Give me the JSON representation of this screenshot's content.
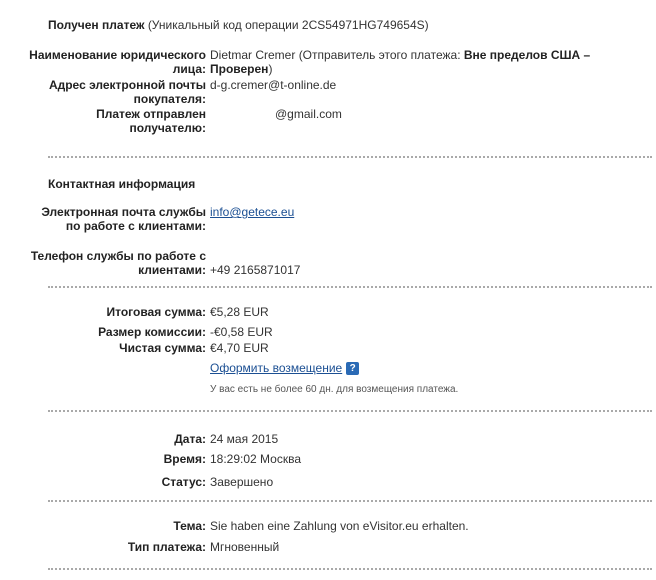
{
  "header": {
    "title": "Получен платеж",
    "code_text": "(Уникальный код операции 2CS54971HG749654S)"
  },
  "sender": {
    "name_label": "Наименование юридического лица:",
    "name_value": "Dietmar Cremer",
    "name_note_pre": "(Отправитель этого платежа: ",
    "name_note_bold": "Вне пределов США – Проверен",
    "name_note_post": ")",
    "email_label": "Адрес электронной почты покупателя:",
    "email_value": "d-g.cremer@t-online.de",
    "sent_to_label": "Платеж отправлен получателю:",
    "sent_to_value": "@gmail.com"
  },
  "contact": {
    "title": "Контактная информация",
    "support_email_label": "Электронная почта службы по работе с клиентами:",
    "support_email_value": "info@getece.eu",
    "support_phone_label": "Телефон службы по работе с клиентами:",
    "support_phone_value": "+49 2165871017"
  },
  "amounts": {
    "total_label": "Итоговая сумма:",
    "total_value": "€5,28 EUR",
    "fee_label": "Размер комиссии:",
    "fee_value": "-€0,58 EUR",
    "net_label": "Чистая сумма:",
    "net_value": "€4,70 EUR",
    "refund_link": "Оформить возмещение",
    "refund_help": "?",
    "refund_note": "У вас есть не более 60 дн. для возмещения платежа."
  },
  "details": {
    "date_label": "Дата:",
    "date_value": "24 мая 2015",
    "time_label": "Время:",
    "time_value": "18:29:02 Москва",
    "status_label": "Статус:",
    "status_value": "Завершено"
  },
  "subject": {
    "subject_label": "Тема:",
    "subject_value": "Sie haben eine Zahlung von eVisitor.eu erhalten.",
    "type_label": "Тип платежа:",
    "type_value": "Мгновенный"
  }
}
